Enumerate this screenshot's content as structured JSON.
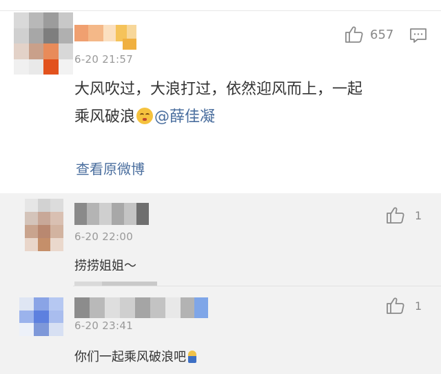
{
  "main_comment": {
    "time": "6-20 21:57",
    "likes": "657",
    "text_line1": "大风吹过，大浪打过，依然迎风而上，一起",
    "text_line2": "乘风破浪",
    "mention": "@薛佳凝",
    "view_original": "查看原微博",
    "icons": [
      "thumbs-up-icon",
      "comment-icon"
    ]
  },
  "replies": [
    {
      "time": "6-20 22:00",
      "likes": "1",
      "text": "捞捞姐姐～"
    },
    {
      "time": "6-20 23:41",
      "likes": "1",
      "text": "你们一起乘风破浪吧"
    }
  ]
}
